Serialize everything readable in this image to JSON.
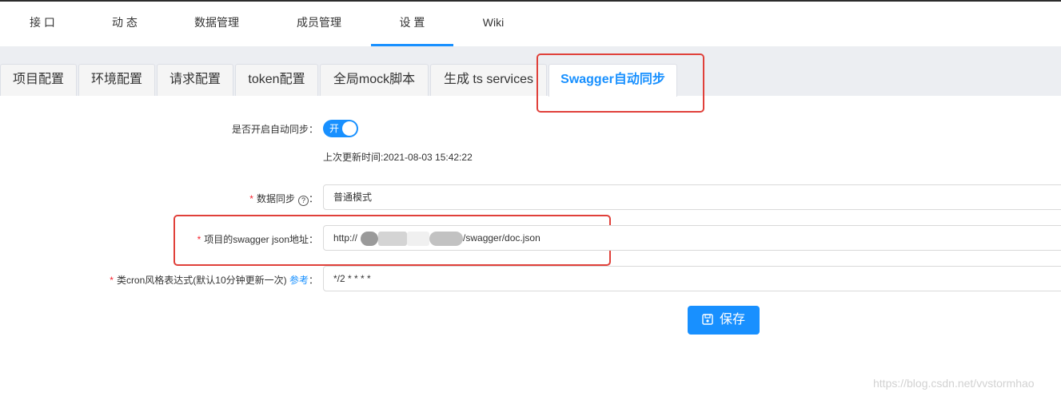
{
  "topnav": {
    "items": [
      {
        "label": "接 口"
      },
      {
        "label": "动 态"
      },
      {
        "label": "数据管理"
      },
      {
        "label": "成员管理"
      },
      {
        "label": "设 置"
      },
      {
        "label": "Wiki"
      }
    ],
    "active_index": 4
  },
  "tabs": {
    "items": [
      {
        "label": "项目配置"
      },
      {
        "label": "环境配置"
      },
      {
        "label": "请求配置"
      },
      {
        "label": "token配置"
      },
      {
        "label": "全局mock脚本"
      },
      {
        "label": "生成 ts services"
      },
      {
        "label": "Swagger自动同步"
      }
    ],
    "active_index": 6
  },
  "form": {
    "auto_sync_label": "是否开启自动同步：",
    "switch_text": "开",
    "switch_on": true,
    "last_update": "上次更新时间:2021-08-03 15:42:22",
    "sync_mode_label": "数据同步",
    "sync_mode_value": "普通模式",
    "swagger_url_label": "项目的swagger json地址：",
    "swagger_url_prefix": "http://",
    "swagger_url_suffix": "/swagger/doc.json",
    "cron_label": "类cron风格表达式(默认10分钟更新一次)",
    "cron_ref_link": "参考",
    "cron_value": "*/2 * * * *",
    "colon": "："
  },
  "save_button": {
    "label": "保存"
  },
  "watermark": "https://blog.csdn.net/vvstormhao",
  "colors": {
    "accent": "#1890ff",
    "highlight": "#e0403a",
    "required": "#f5222d"
  }
}
